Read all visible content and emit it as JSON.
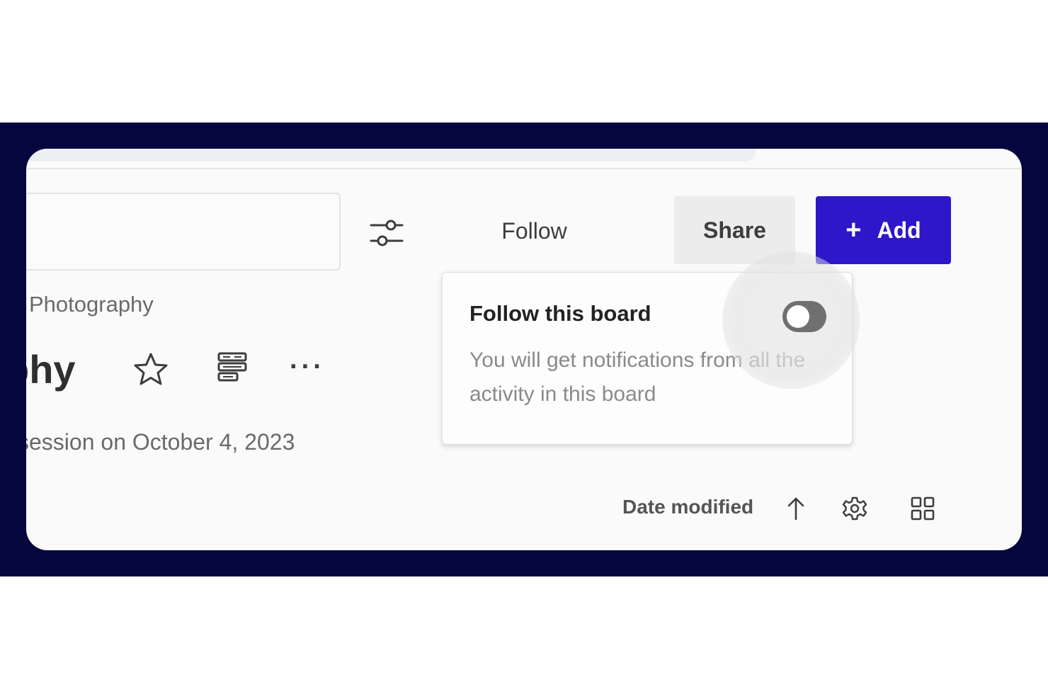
{
  "toolbar": {
    "follow_label": "Follow",
    "share_label": "Share",
    "add_label": "Add",
    "add_icon": "+"
  },
  "board": {
    "breadcrumb": "Photography",
    "title_partial": "phy",
    "subtitle_partial": "session on October 4, 2023",
    "more_icon": "···"
  },
  "popover": {
    "title": "Follow this board",
    "description": "You will get notifications from all the activity in this board",
    "toggle_on": false
  },
  "view": {
    "sort_label": "Date modified",
    "sort_direction": "ascending"
  },
  "icons": [
    "filter-sliders-icon",
    "star-icon",
    "layout-icon",
    "more-icon",
    "arrow-up-icon",
    "gear-icon",
    "grid-view-icon"
  ],
  "colors": {
    "accent": "#2d17c9",
    "frame": "#05063d",
    "toggle_off": "#707070"
  }
}
